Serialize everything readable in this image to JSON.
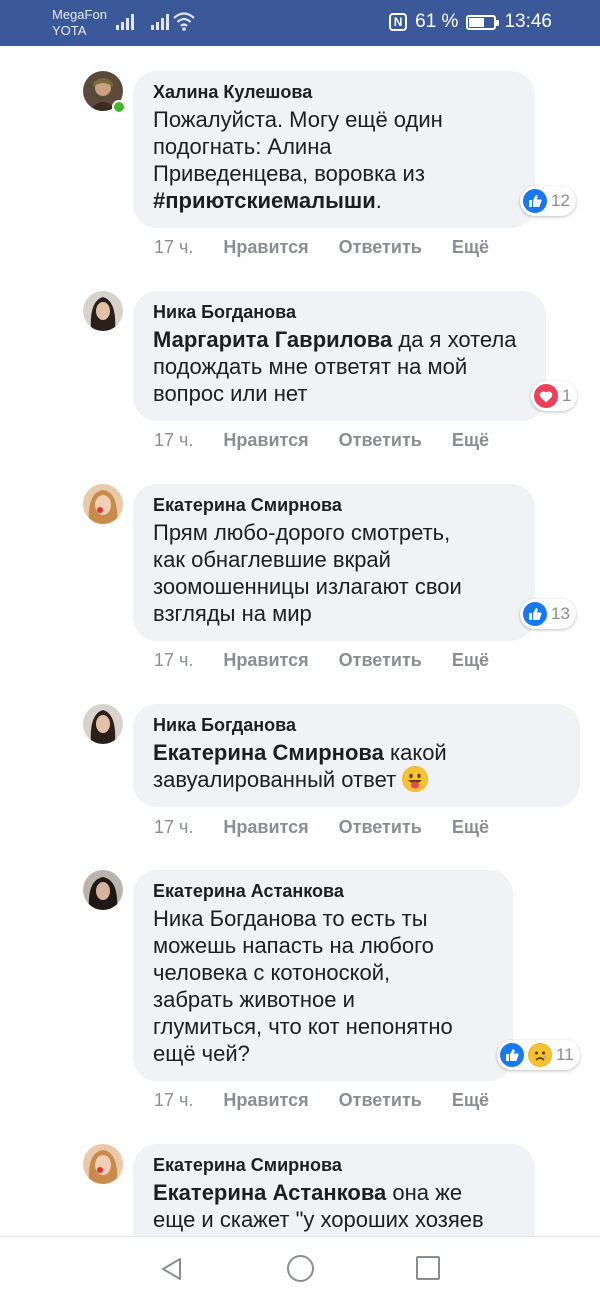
{
  "status_bar": {
    "carrier_1": "MegaFon",
    "carrier_2": "YOTA",
    "nfc": "N",
    "battery_text": "61 %",
    "battery_level": 0.61,
    "time": "13:46"
  },
  "comments": [
    {
      "author": "Халина Кулешова",
      "text_plain": "Пожалуйста. Могу ещё один\nподогнать: Алина\nПриведенцева, воровка из\n",
      "text_bold": "#приютскиемалыши",
      "text_after": ".",
      "time": "17 ч.",
      "reaction_count": "12",
      "reaction_icons": [
        "like-icon"
      ],
      "online": true
    },
    {
      "author": "Ника Богданова",
      "mention": "Маргарита Гаврилова",
      "text": " да я хотела\nподождать мне ответят на мой\nвопрос или нет",
      "time": "17 ч.",
      "reaction_count": "1",
      "reaction_icons": [
        "love-icon"
      ]
    },
    {
      "author": "Екатерина Смирнова",
      "text": "Прям любо-дорого смотреть,\nкак обнаглевшие вкрай\nзоомошенницы излагают свои\nвзгляды на мир",
      "time": "17 ч.",
      "reaction_count": "13",
      "reaction_icons": [
        "like-icon"
      ]
    },
    {
      "author": "Ника Богданова",
      "mention": "Екатерина Смирнова",
      "text": " какой\nзавуалированный ответ ",
      "emoji": "grinning-tongue-emoji",
      "time": "17 ч."
    },
    {
      "author": "Екатерина Астанкова",
      "text": "Ника Богданова то есть ты\nможешь напасть на любого\nчеловека с котоноской,\nзабрать животное и\nглумиться, что кот непонятно\nещё чей?",
      "time": "17 ч.",
      "reaction_count": "11",
      "reaction_icons": [
        "like-icon",
        "sad-icon"
      ]
    },
    {
      "author": "Екатерина Смирнова",
      "mention": "Екатерина Астанкова",
      "text": " она же\nеще и скажет \"у хороших хозяев"
    }
  ],
  "actions": {
    "like": "Нравится",
    "reply": "Ответить",
    "more": "Ещё"
  },
  "colors": {
    "header_blue": "#3b5998",
    "bubble_bg": "#f0f2f5",
    "meta_gray": "#8a8d91",
    "like_blue": "#1877f2",
    "love_red": "#f33e58",
    "online_green": "#42b72a"
  },
  "nav": {
    "back": "back-icon",
    "home": "home-icon",
    "recents": "recents-icon"
  }
}
